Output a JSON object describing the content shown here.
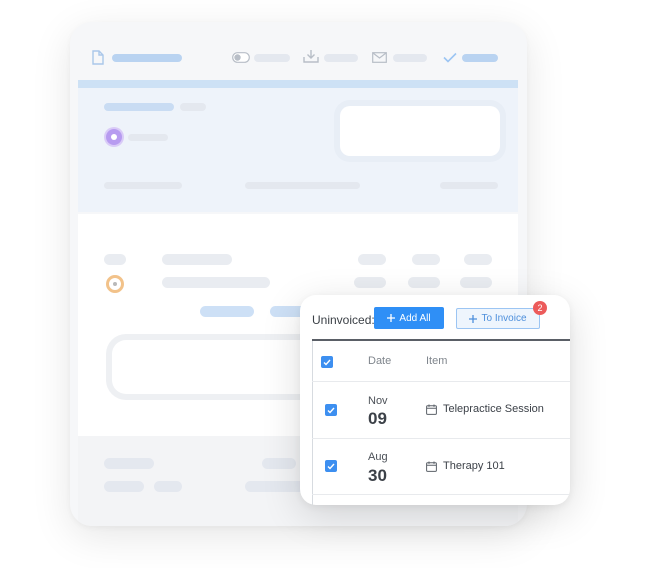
{
  "popup": {
    "uninvoiced_label": "Uninvoiced:",
    "add_all_label": "Add All",
    "to_invoice_label": "To Invoice",
    "badge_count": "2",
    "columns": {
      "date": "Date",
      "item": "Item"
    },
    "rows": [
      {
        "month": "Nov",
        "day": "09",
        "item": "Telepractice Session"
      },
      {
        "month": "Aug",
        "day": "30",
        "item": "Therapy 101"
      }
    ]
  },
  "colors": {
    "accent": "#2f8ff6",
    "badge": "#ec5b5b",
    "checkbox": "#3d8ff0"
  },
  "icons": [
    "document-icon",
    "toggle-icon",
    "download-icon",
    "mail-icon",
    "check-icon",
    "plus-icon",
    "calendar-icon",
    "checkbox-checked-icon"
  ]
}
